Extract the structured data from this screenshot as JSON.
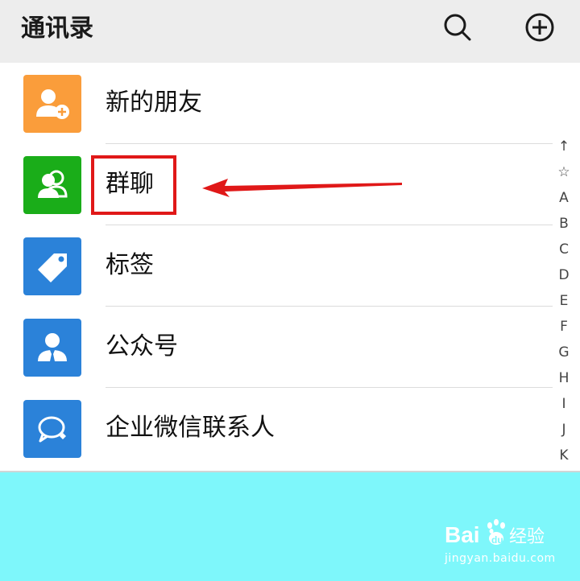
{
  "header": {
    "title": "通讯录",
    "search_icon": "search-icon",
    "add_icon": "plus-circle-icon"
  },
  "contacts_menu": [
    {
      "label": "新的朋友",
      "icon": "add-friend-icon",
      "color": "#fa9d3b"
    },
    {
      "label": "群聊",
      "icon": "group-chat-icon",
      "color": "#1aad19"
    },
    {
      "label": "标签",
      "icon": "tag-icon",
      "color": "#2b82d9"
    },
    {
      "label": "公众号",
      "icon": "official-account-icon",
      "color": "#2b82d9"
    },
    {
      "label": "企业微信联系人",
      "icon": "work-chat-icon",
      "color": "#2b82d9"
    }
  ],
  "index_bar": [
    "↑",
    "☆",
    "A",
    "B",
    "C",
    "D",
    "E",
    "F",
    "G",
    "H",
    "I",
    "J",
    "K"
  ],
  "annotation": {
    "highlight_color": "#e01818",
    "target": "群聊"
  },
  "watermark": {
    "brand": "Bai",
    "brand_suffix": "du",
    "cn": "经验",
    "url": "jingyan.baidu.com"
  }
}
